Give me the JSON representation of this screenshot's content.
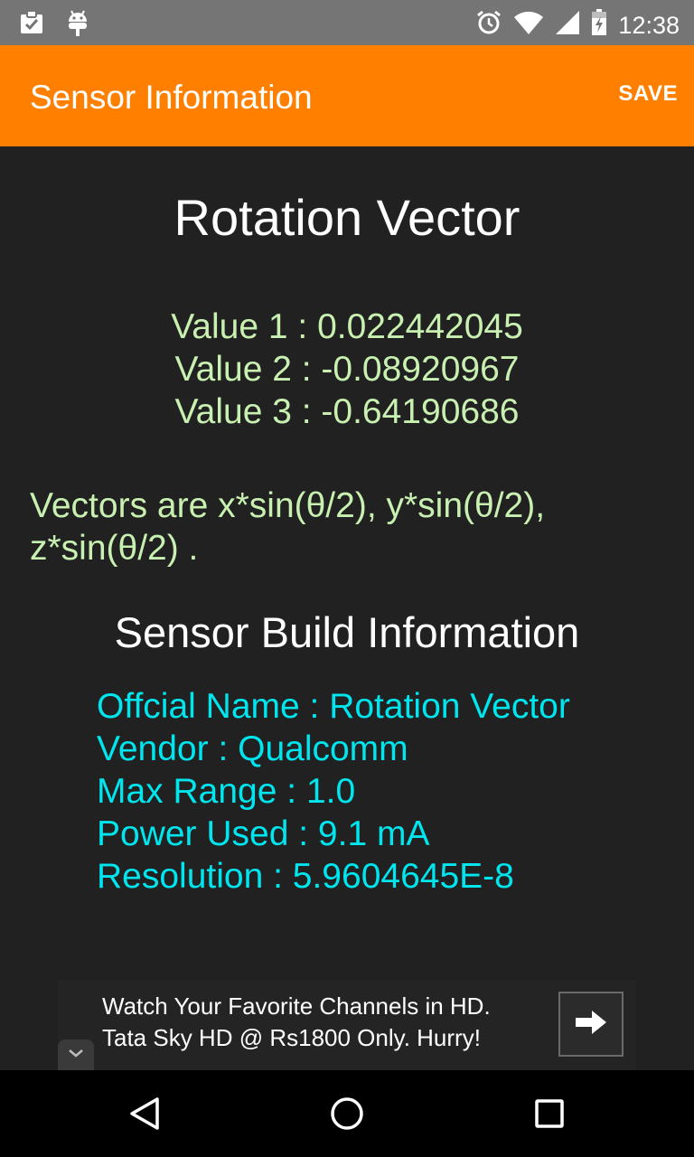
{
  "status_bar": {
    "time": "12:38",
    "left_icons": [
      "clipboard-check-icon",
      "android-debug-icon"
    ],
    "right_icons": [
      "alarm-icon",
      "wifi-icon",
      "signal-icon",
      "battery-icon"
    ]
  },
  "app_bar": {
    "title": "Sensor Information",
    "save_label": "SAVE",
    "color": "#FF8000"
  },
  "sensor": {
    "name": "Rotation Vector",
    "values": [
      "Value 1 : 0.022442045",
      "Value 2 : -0.08920967",
      "Value 3 : -0.64190686"
    ],
    "note": "Vectors are x*sin(θ/2), y*sin(θ/2), z*sin(θ/2) ."
  },
  "build": {
    "heading": "Sensor Build Information",
    "lines": [
      "Offcial Name : Rotation Vector",
      "Vendor : Qualcomm",
      "Max Range : 1.0",
      "Power Used : 9.1 mA",
      "Resolution : 5.9604645E-8"
    ]
  },
  "ad": {
    "line1": "Watch Your Favorite Channels in HD.",
    "line2": "Tata Sky HD @ Rs1800 Only. Hurry!",
    "arrow_icon": "arrow-right-icon",
    "collapse_icon": "chevron-down-icon"
  },
  "nav_bar": {
    "icons": [
      "back-icon",
      "home-icon",
      "recents-icon"
    ]
  },
  "colors": {
    "value_text": "#c8f0b0",
    "build_text": "#00E5EE",
    "background": "#212121"
  }
}
